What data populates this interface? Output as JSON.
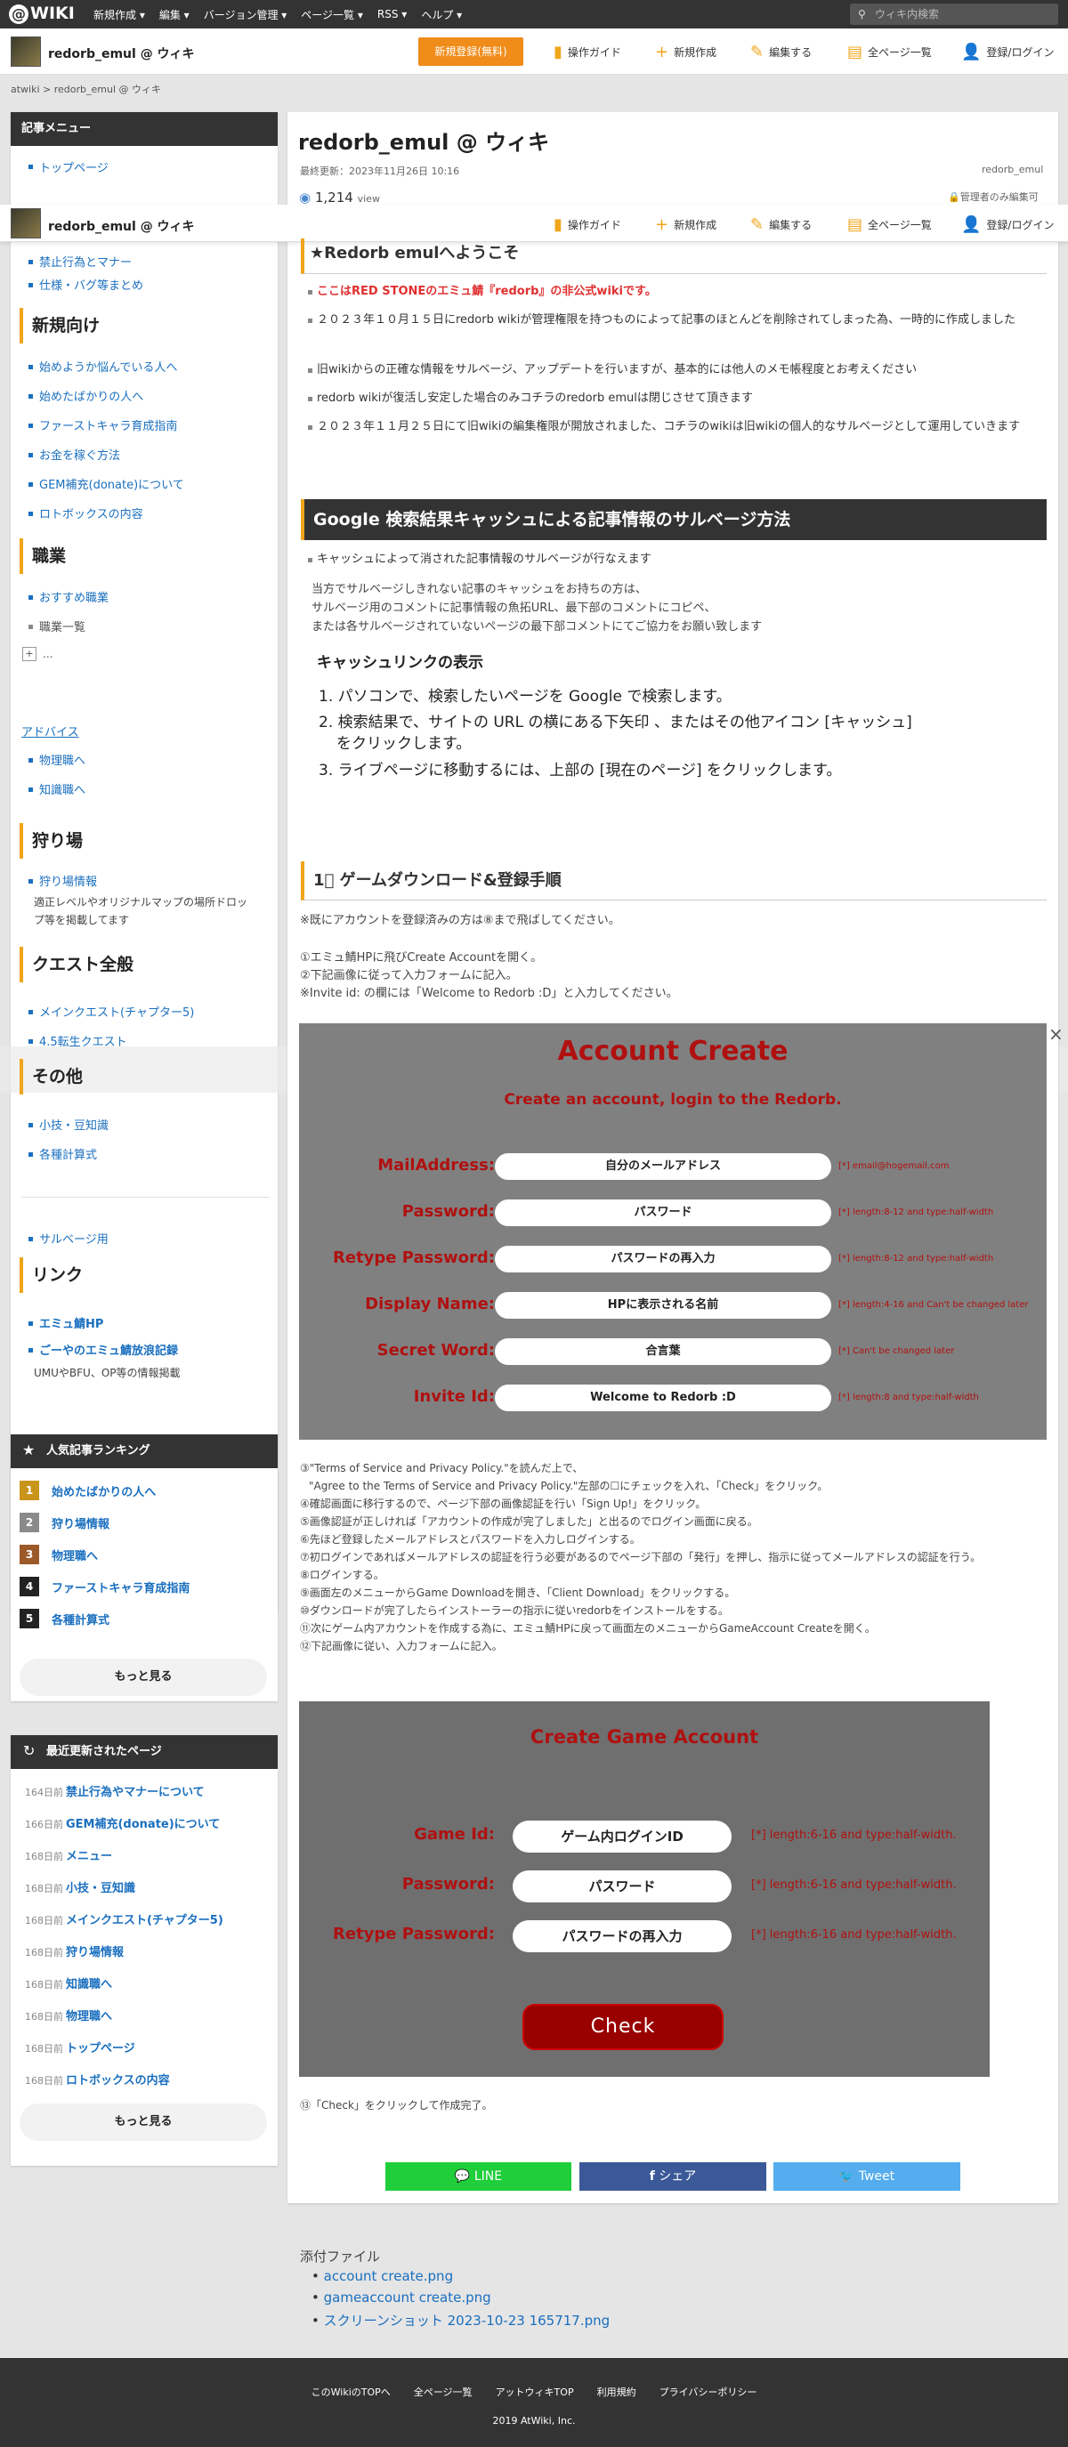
{
  "topbar": {
    "logo": "WIKI",
    "nav": [
      "新規作成 ▾",
      "編集 ▾",
      "バージョン管理 ▾",
      "ページ一覧 ▾",
      "RSS ▾",
      "ヘルプ ▾"
    ],
    "search_placeholder": "ウィキ内検索"
  },
  "header": {
    "site_name": "redorb_emul @ ウィキ",
    "register_button": "新規登録(無料)",
    "nav": [
      "操作ガイド",
      "新規作成",
      "編集する",
      "全ページ一覧",
      "登録/ログイン"
    ]
  },
  "breadcrumb": "atwiki > redorb_emul @ ウィキ",
  "page": {
    "title": "redorb_emul @ ウィキ",
    "last_updated": "最終更新：2023年11月26日 10:16",
    "author": "redorb_emul",
    "views": "1,214",
    "views_unit": "view",
    "edit_perm": "管理者のみ編集可"
  },
  "sidebar": {
    "menu_title": "記事メニュー",
    "top_items": [
      "トップページ",
      "禁止行為とマナー",
      "仕様・バグ等まとめ"
    ],
    "sections": {
      "beginners": {
        "title": "新規向け",
        "items": [
          "始めようか悩んでいる人へ",
          "始めたばかりの人へ",
          "ファーストキャラ育成指南",
          "お金を稼ぐ方法",
          "GEM補充(donate)について",
          "ロトボックスの内容"
        ]
      },
      "jobs": {
        "title": "職業",
        "items": [
          "おすすめ職業"
        ],
        "plain": "職業一覧",
        "expand": "..."
      },
      "advice": {
        "title": "アドバイス",
        "items": [
          "物理職へ",
          "知識職へ"
        ]
      },
      "hunting": {
        "title": "狩り場",
        "items": [
          "狩り場情報"
        ],
        "note": "適正レベルやオリジナルマップの場所ドロップ等を掲載してます"
      },
      "quest": {
        "title": "クエスト全般",
        "items": [
          "メインクエスト(チャプター5)",
          "4.5転生クエスト"
        ]
      },
      "other": {
        "title": "その他",
        "items": [
          "小技・豆知識",
          "各種計算式"
        ]
      },
      "salvage": {
        "items": [
          "サルベージ用"
        ]
      },
      "links": {
        "title": "リンク",
        "items": [
          "エミュ鯖HP",
          "ごーやのエミュ鯖放浪記録"
        ],
        "note": "UMUやBFU、OP等の情報掲載"
      }
    },
    "ranking": {
      "title": "人気記事ランキング",
      "items": [
        "始めたばかりの人へ",
        "狩り場情報",
        "物理職へ",
        "ファーストキャラ育成指南",
        "各種計算式"
      ],
      "more": "もっと見る"
    },
    "recent": {
      "title": "最近更新されたページ",
      "items": [
        {
          "days": "164日前",
          "title": "禁止行為やマナーについて"
        },
        {
          "days": "166日前",
          "title": "GEM補充(donate)について"
        },
        {
          "days": "168日前",
          "title": "メニュー"
        },
        {
          "days": "168日前",
          "title": "小技・豆知識"
        },
        {
          "days": "168日前",
          "title": "メインクエスト(チャプター5)"
        },
        {
          "days": "168日前",
          "title": "狩り場情報"
        },
        {
          "days": "168日前",
          "title": "知識職へ"
        },
        {
          "days": "168日前",
          "title": "物理職へ"
        },
        {
          "days": "168日前",
          "title": "トップページ"
        },
        {
          "days": "168日前",
          "title": "ロトボックスの内容"
        }
      ],
      "more": "もっと見る"
    }
  },
  "content": {
    "welcome_title": "★Redorb emulへようこそ",
    "bullets": [
      "ここはRED STONEのエミュ鯖『redorb』の非公式wikiです。",
      "２０２３年１０月１５日にredorb wikiが管理権限を持つものによって記事のほとんどを削除されてしまった為、一時的に作成しました",
      "旧wikiからの正確な情報をサルベージ、アップデートを行いますが、基本的には他人のメモ帳程度とお考えください",
      "redorb wikiが復活し安定した場合のみコチラのredorb emulは閉じさせて頂きます",
      "２０２３年１１月２５日にて旧wikiの編集権限が開放されました、コチラのwikiは旧wikiの個人的なサルベージとして運用していきます"
    ],
    "cache_title": "Google 検索結果キャッシュによる記事情報のサルベージ方法",
    "cache_bullet": "キャッシュによって消された記事情報のサルベージが行なえます",
    "cache_para": [
      "当方でサルベージしきれない記事のキャッシュをお持ちの方は、",
      "サルベージ用のコメントに記事情報の魚拓URL、最下部のコメントにコピペ、",
      "または各サルベージされていないページの最下部コメントにてご協力をお願い致します"
    ],
    "cache_link": "サルベージ用",
    "cache_display_title": "キャッシュリンクの表示",
    "cache_steps": [
      "1. パソコンで、検索したいページを Google で検索します。",
      "2. 検索結果で、サイトの URL の横にある下矢印 、またはその他アイコン [キャッシュ]",
      "をクリックします。",
      "3. ライブページに移動するには、上部の [現在のページ] をクリックします。"
    ],
    "dl_title": "1⃣ ゲームダウンロード&登録手順",
    "dl_intro": "※既にアカウントを登録済みの方は⑧まで飛ばしてください。",
    "dl_steps1": [
      "①エミュ鯖HPに飛びCreate Accountを開く。",
      "②下記画像に従って入力フォームに記入。",
      "※Invite id: の欄には「Welcome to Redorb :D」と入力してください。"
    ],
    "account": {
      "title": "Account Create",
      "subtitle": "Create an account, login to the Redorb.",
      "fields": [
        {
          "label": "MailAddress:",
          "value": "自分のメールアドレス",
          "note": "[*] email@hogemail.com"
        },
        {
          "label": "Password:",
          "value": "パスワード",
          "note": "[*] length:8-12 and type:half-width"
        },
        {
          "label": "Retype Password:",
          "value": "パスワードの再入力",
          "note": "[*] length:8-12 and type:half-width"
        },
        {
          "label": "Display Name:",
          "value": "HPに表示される名前",
          "note": "[*] length:4-16 and Can't be changed later"
        },
        {
          "label": "Secret Word:",
          "value": "合言葉",
          "note": "[*] Can't be changed later"
        },
        {
          "label": "Invite Id:",
          "value": "Welcome to Redorb :D",
          "note": "[*] length:8 and type:half-width"
        }
      ]
    },
    "dl_steps2": [
      "③\"Terms of Service and Privacy Policy.\"を読んだ上で、",
      "\"Agree to the Terms of Service and Privacy Policy.\"左部の☐にチェックを入れ、「Check」をクリック。",
      "④確認画面に移行するので、ページ下部の画像認証を行い「Sign Up!」をクリック。",
      "⑤画像認証が正しければ「アカウントの作成が完了しました」と出るのでログイン画面に戻る。",
      "⑥先ほど登録したメールアドレスとパスワードを入力しログインする。",
      "⑦初ログインであればメールアドレスの認証を行う必要があるのでページ下部の「発行」を押し、指示に従ってメールアドレスの認証を行う。",
      "⑧ログインする。",
      "⑨画面左のメニューからGame Downloadを開き、「Client Download」をクリックする。",
      "⑩ダウンロードが完了したらインストーラーの指示に従いredorbをインストールをする。",
      "⑪次にゲーム内アカウントを作成する為に、エミュ鯖HPに戻って画面左のメニューからGameAccount Createを開く。",
      "⑫下記画像に従い、入力フォームに記入。"
    ],
    "game_account": {
      "title": "Create Game Account",
      "fields": [
        {
          "label": "Game Id:",
          "value": "ゲーム内ログインID",
          "note": "[*] length:6-16 and type:half-width."
        },
        {
          "label": "Password:",
          "value": "パスワード",
          "note": "[*] length:6-16 and type:half-width."
        },
        {
          "label": "Retype Password:",
          "value": "パスワードの再入力",
          "note": "[*] length:6-16 and type:half-width."
        }
      ],
      "button": "Check"
    },
    "final_step": "⑬「Check」をクリックして作成完了。",
    "share": {
      "line": "LINE",
      "facebook": "シェア",
      "twitter": "Tweet"
    },
    "attachments_title": "添付ファイル",
    "attachments": [
      "account create.png",
      "gameaccount create.png",
      "スクリーンショット 2023-10-23 165717.png"
    ]
  },
  "footer": {
    "links": [
      "このWikiのTOPへ",
      "全ページ一覧",
      "アットウィキTOP",
      "利用規約",
      "プライバシーポリシー"
    ],
    "copyright": "2019 AtWiki, Inc."
  }
}
